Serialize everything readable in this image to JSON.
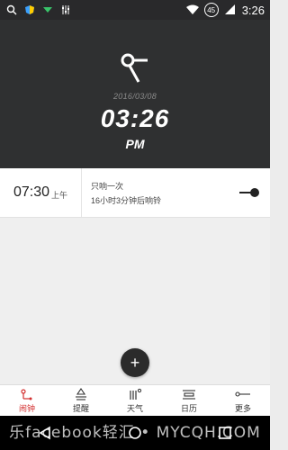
{
  "statusbar": {
    "time": "3:26",
    "battery_badge": "45"
  },
  "hero": {
    "date": "2016/03/08",
    "time": "03:26",
    "ampm": "PM"
  },
  "alarm": {
    "time": "07:30",
    "suffix": "上午",
    "repeat": "只响一次",
    "remaining": "16小时3分钟后响铃"
  },
  "fab": {
    "label": "+"
  },
  "tabs": [
    {
      "label": "闹钟",
      "active": true
    },
    {
      "label": "提醒",
      "active": false
    },
    {
      "label": "天气",
      "active": false
    },
    {
      "label": "日历",
      "active": false
    },
    {
      "label": "更多",
      "active": false
    }
  ],
  "watermark": "乐facebook轻汇 • MYCQH.COM",
  "colors": {
    "accent": "#d32f2f",
    "hero_bg": "#2f3031",
    "status_bg": "#29292b"
  }
}
